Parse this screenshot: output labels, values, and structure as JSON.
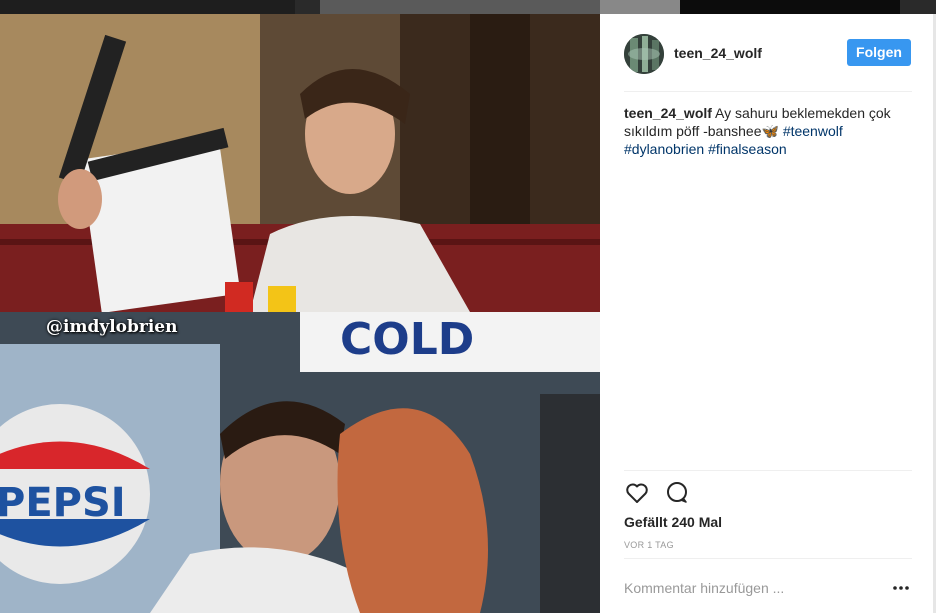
{
  "post": {
    "username": "teen_24_wolf",
    "follow_label": "Folgen",
    "caption_text": " Ay sahuru beklemekden çok sıkıldım pöff -banshee",
    "emoji": "🦋",
    "hashtags": [
      "#teenwolf",
      "#dylanobrien",
      "#finalseason"
    ],
    "likes": "Gefällt 240 Mal",
    "time": "VOR 1 TAG",
    "comment_placeholder": "Kommentar hinzufügen ...",
    "more_label": "•••"
  },
  "photo": {
    "watermark": "@imdylobrien",
    "sign_text": "COLD",
    "pepsi_text": "PEPSI"
  },
  "icons": {
    "like": "heart-icon",
    "comment": "comment-icon",
    "more": "more-options-icon"
  },
  "colors": {
    "accent": "#3897f0",
    "hashtag": "#003569",
    "text": "#262626",
    "muted": "#999999"
  }
}
